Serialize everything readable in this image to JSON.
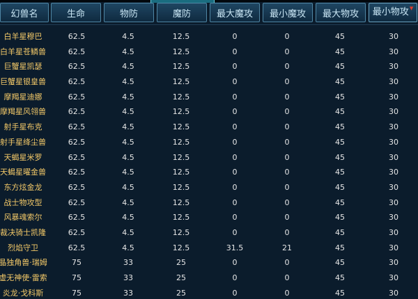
{
  "headers": [
    "幻兽名",
    "生命",
    "物防",
    "魔防",
    "最大魔攻",
    "最小魔攻",
    "最大物攻",
    "最小物攻"
  ],
  "sorted_column_marker": "▼",
  "rows": [
    [
      "白羊星穆巴",
      "62.5",
      "4.5",
      "12.5",
      "0",
      "0",
      "45",
      "30"
    ],
    [
      "白羊星苍鳞兽",
      "62.5",
      "4.5",
      "12.5",
      "0",
      "0",
      "45",
      "30"
    ],
    [
      "巨蟹星凯瑟",
      "62.5",
      "4.5",
      "12.5",
      "0",
      "0",
      "45",
      "30"
    ],
    [
      "巨蟹星银皇兽",
      "62.5",
      "4.5",
      "12.5",
      "0",
      "0",
      "45",
      "30"
    ],
    [
      "摩羯星迪娜",
      "62.5",
      "4.5",
      "12.5",
      "0",
      "0",
      "45",
      "30"
    ],
    [
      "摩羯星风翎兽",
      "62.5",
      "4.5",
      "12.5",
      "0",
      "0",
      "45",
      "30"
    ],
    [
      "射手星布克",
      "62.5",
      "4.5",
      "12.5",
      "0",
      "0",
      "45",
      "30"
    ],
    [
      "射手星绛尘兽",
      "62.5",
      "4.5",
      "12.5",
      "0",
      "0",
      "45",
      "30"
    ],
    [
      "天蝎星米罗",
      "62.5",
      "4.5",
      "12.5",
      "0",
      "0",
      "45",
      "30"
    ],
    [
      "天蝎星曜金兽",
      "62.5",
      "4.5",
      "12.5",
      "0",
      "0",
      "45",
      "30"
    ],
    [
      "东方炫金龙",
      "62.5",
      "4.5",
      "12.5",
      "0",
      "0",
      "45",
      "30"
    ],
    [
      "战士物攻型",
      "62.5",
      "4.5",
      "12.5",
      "0",
      "0",
      "45",
      "30"
    ],
    [
      "风暴魂索尔",
      "62.5",
      "4.5",
      "12.5",
      "0",
      "0",
      "45",
      "30"
    ],
    [
      "裁决骑士凯隆",
      "62.5",
      "4.5",
      "12.5",
      "0",
      "0",
      "45",
      "30"
    ],
    [
      "烈焰守卫",
      "62.5",
      "4.5",
      "12.5",
      "31.5",
      "21",
      "45",
      "30"
    ],
    [
      "晶独角兽·瑞姆",
      "75",
      "33",
      "25",
      "0",
      "0",
      "45",
      "30"
    ],
    [
      "虚无神使·雷索",
      "75",
      "33",
      "25",
      "0",
      "0",
      "45",
      "30"
    ],
    [
      "炎龙·戈科斯",
      "75",
      "33",
      "25",
      "0",
      "0",
      "45",
      "30"
    ]
  ],
  "colors": {
    "background": "#0b1c2c",
    "name_text": "#f2c868",
    "value_text": "#e6e6e6",
    "header_text": "#c9e6f4",
    "header_border": "#4f86a4",
    "sort_arrow": "#e03a2a"
  }
}
